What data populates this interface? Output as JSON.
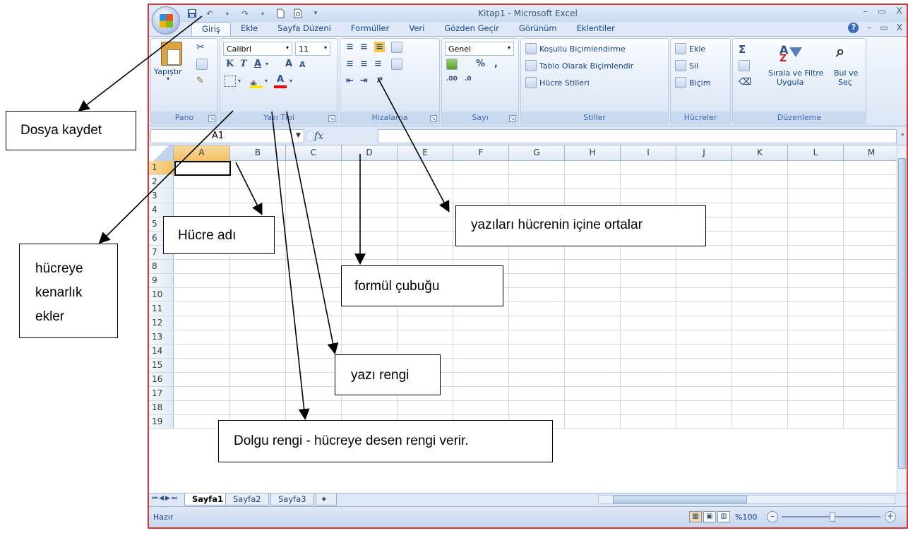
{
  "window": {
    "title": "Kitap1 - Microsoft Excel",
    "controls": [
      "–",
      "▭",
      "X"
    ],
    "doc_controls": [
      "?",
      "–",
      "▭",
      "X"
    ]
  },
  "tabs": [
    "Giriş",
    "Ekle",
    "Sayfa Düzeni",
    "Formüller",
    "Veri",
    "Gözden Geçir",
    "Görünüm",
    "Eklentiler"
  ],
  "ribbon": {
    "pano": {
      "title": "Pano",
      "paste": "Yapıştır"
    },
    "font": {
      "title": "Yazı Tipi",
      "name": "Calibri",
      "size": "11",
      "bold": "K",
      "italic": "T",
      "underline": "A",
      "grow": "A",
      "shrink": "A",
      "color": "A"
    },
    "align": {
      "title": "Hizalama"
    },
    "number": {
      "title": "Sayı",
      "format": "Genel",
      "percent": "%",
      "comma": ","
    },
    "styles": {
      "title": "Stiller",
      "cond": "Koşullu Biçimlendirme",
      "table": "Tablo Olarak Biçimlendir",
      "cell": "Hücre Stilleri"
    },
    "cells": {
      "title": "Hücreler",
      "insert": "Ekle",
      "delete": "Sil",
      "format": "Biçim"
    },
    "edit": {
      "title": "Düzenleme",
      "sum": "Σ",
      "sort1": "Sırala ve Filtre",
      "sort2": "Uygula",
      "find1": "Bul ve",
      "find2": "Seç"
    }
  },
  "formula_bar": {
    "name_box": "A1",
    "fx": "fx",
    "value": ""
  },
  "columns": [
    "A",
    "B",
    "C",
    "D",
    "E",
    "F",
    "G",
    "H",
    "I",
    "J",
    "K",
    "L",
    "M"
  ],
  "rows": [
    "1",
    "2",
    "3",
    "4",
    "5",
    "6",
    "7",
    "8",
    "9",
    "10",
    "11",
    "12",
    "13",
    "14",
    "15",
    "16",
    "17",
    "18",
    "19"
  ],
  "selected_cell": "A1",
  "sheets": [
    "Sayfa1",
    "Sayfa2",
    "Sayfa3"
  ],
  "status": {
    "text": "Hazır",
    "zoom": "%100"
  },
  "callouts": {
    "save": "Dosya kaydet",
    "border": "hücreye kenarlık ekler",
    "border_lines": [
      "hücreye",
      "kenarlık",
      "ekler"
    ],
    "name": "Hücre adı",
    "center": "yazıları hücrenin içine ortalar",
    "formula": "formül çubuğu",
    "fontcolor": "yazı rengi",
    "fill": "Dolgu rengi - hücreye desen rengi verir."
  }
}
